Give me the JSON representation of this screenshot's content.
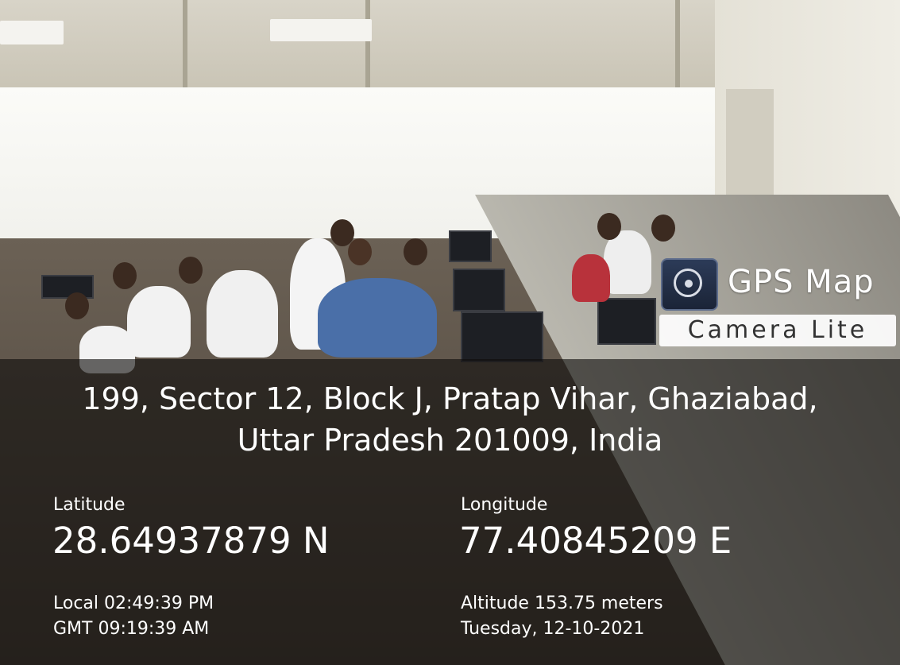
{
  "watermark": {
    "brand_line1": "GPS Map",
    "brand_line2": "Camera Lite",
    "logo_icon": "camera-lens-icon"
  },
  "location": {
    "address": "199, Sector 12, Block J, Pratap Vihar, Ghaziabad, Uttar Pradesh 201009, India",
    "latitude_label": "Latitude",
    "latitude_value": "28.64937879 N",
    "longitude_label": "Longitude",
    "longitude_value": "77.40845209 E",
    "local_time": "Local 02:49:39 PM",
    "gmt_time": "GMT 09:19:39 AM",
    "altitude": "Altitude 153.75 meters",
    "date": "Tuesday, 12-10-2021"
  }
}
